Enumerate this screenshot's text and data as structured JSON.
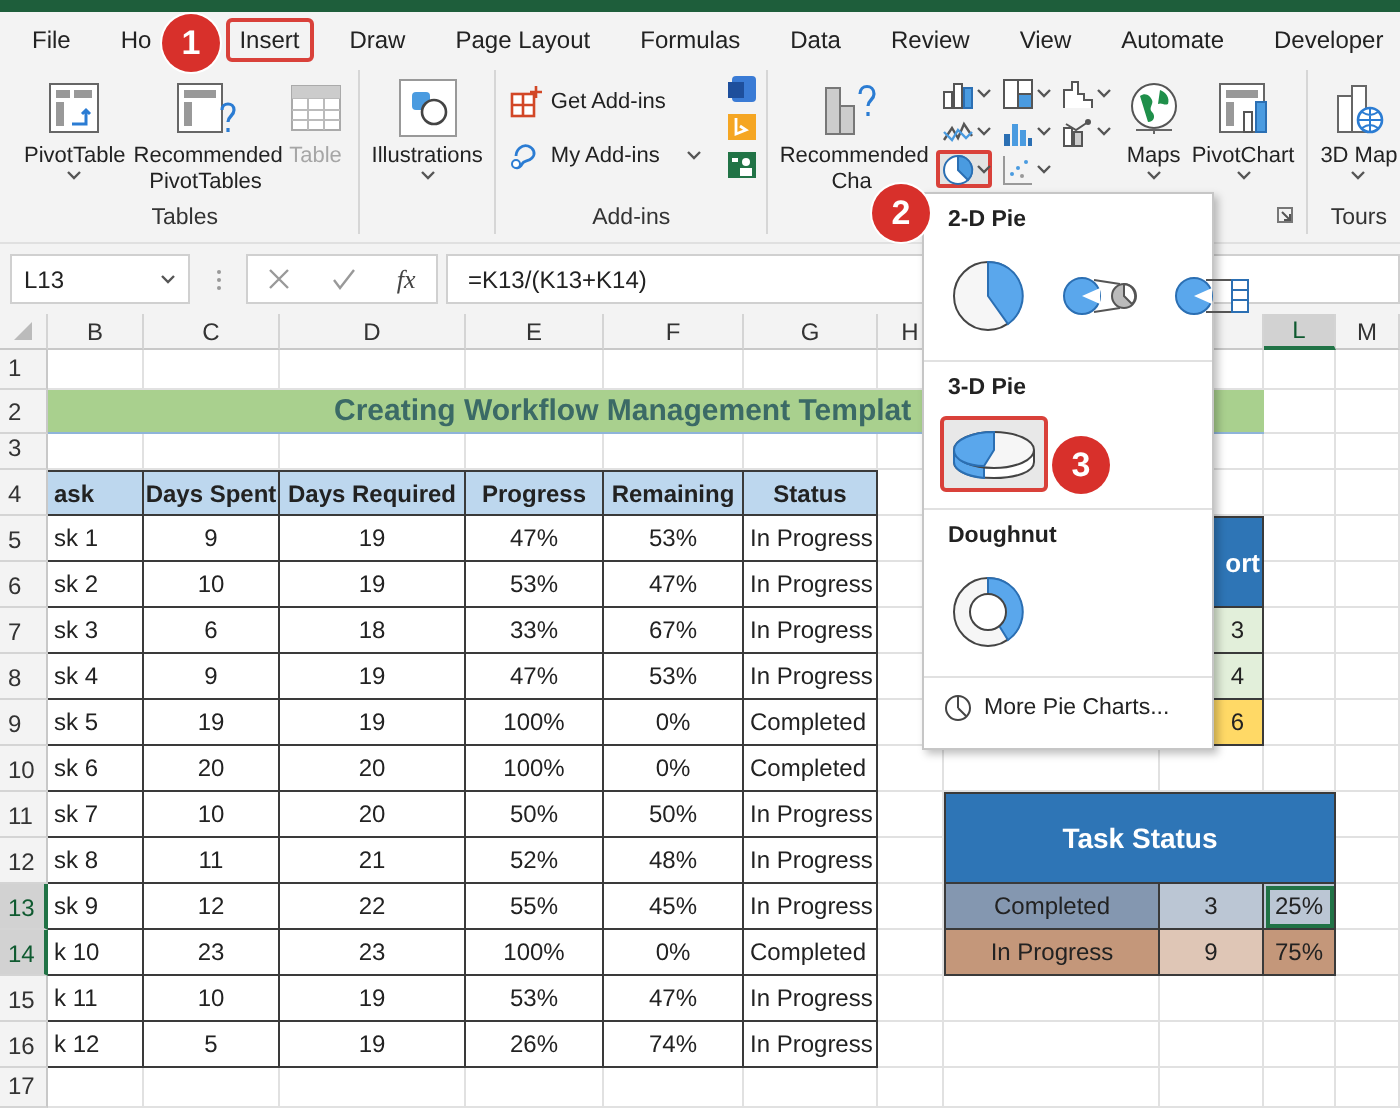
{
  "tabs": [
    {
      "label": "File",
      "selected": false
    },
    {
      "label": "Ho",
      "selected": false
    },
    {
      "label": "Insert",
      "selected": true
    },
    {
      "label": "Draw",
      "selected": false
    },
    {
      "label": "Page Layout",
      "selected": false
    },
    {
      "label": "Formulas",
      "selected": false
    },
    {
      "label": "Data",
      "selected": false
    },
    {
      "label": "Review",
      "selected": false
    },
    {
      "label": "View",
      "selected": false
    },
    {
      "label": "Automate",
      "selected": false
    },
    {
      "label": "Developer",
      "selected": false
    }
  ],
  "ribbon": {
    "groups": [
      {
        "label": "Tables",
        "items": [
          {
            "kind": "large",
            "label": "PivotTable",
            "dropdown": true,
            "disabled": false
          },
          {
            "kind": "large",
            "label": "Recommended PivotTables",
            "dropdown": false,
            "disabled": false
          },
          {
            "kind": "large",
            "label": "Table",
            "dropdown": false,
            "disabled": true
          }
        ]
      },
      {
        "items": [
          {
            "kind": "large",
            "label": "Illustrations",
            "dropdown": true,
            "disabled": false
          }
        ]
      },
      {
        "label": "Add-ins",
        "items": [
          {
            "kind": "small",
            "label": "Get Add-ins",
            "dropdown": false,
            "disabled": false
          },
          {
            "kind": "small",
            "label": "My Add-ins",
            "dropdown": true,
            "disabled": false
          },
          {
            "kind": "app-icons"
          }
        ]
      },
      {
        "items": [
          {
            "kind": "large",
            "label": "Recommended Cha",
            "dropdown": false,
            "disabled": false
          },
          {
            "kind": "chart-grid",
            "buttons": [
              {
                "selected": false
              },
              {
                "selected": false
              },
              {
                "selected": false
              },
              {
                "selected": false
              },
              {
                "selected": false
              },
              {
                "selected": false
              },
              {
                "selected": true
              },
              {
                "selected": false
              }
            ]
          },
          {
            "kind": "large",
            "label": "Maps",
            "dropdown": true,
            "disabled": false
          },
          {
            "kind": "large",
            "label": "PivotChart",
            "dropdown": true,
            "disabled": false
          }
        ]
      },
      {
        "label": "Tours",
        "items": [
          {
            "kind": "large",
            "label": "3D Map",
            "dropdown": true,
            "disabled": false
          }
        ]
      }
    ]
  },
  "callouts": [
    "1",
    "2",
    "3"
  ],
  "formula_bar": {
    "name_box": "L13",
    "function_button": "fx",
    "formula": "=K13/(K13+K14)"
  },
  "sheet": {
    "columns": [
      {
        "label": "B",
        "selected": false
      },
      {
        "label": "C",
        "selected": false
      },
      {
        "label": "D",
        "selected": false
      },
      {
        "label": "E",
        "selected": false
      },
      {
        "label": "F",
        "selected": false
      },
      {
        "label": "G",
        "selected": false
      },
      {
        "label": "H",
        "selected": false
      },
      {
        "label": "L",
        "selected": true
      },
      {
        "label": "M",
        "selected": false
      }
    ],
    "rows": [
      {
        "label": "1",
        "selected": false
      },
      {
        "label": "2",
        "selected": false
      },
      {
        "label": "3",
        "selected": false
      },
      {
        "label": "4",
        "selected": false
      },
      {
        "label": "5",
        "selected": false
      },
      {
        "label": "6",
        "selected": false
      },
      {
        "label": "7",
        "selected": false
      },
      {
        "label": "8",
        "selected": false
      },
      {
        "label": "9",
        "selected": false
      },
      {
        "label": "10",
        "selected": false
      },
      {
        "label": "11",
        "selected": false
      },
      {
        "label": "12",
        "selected": false
      },
      {
        "label": "13",
        "selected": true
      },
      {
        "label": "14",
        "selected": true
      },
      {
        "label": "15",
        "selected": false
      },
      {
        "label": "16",
        "selected": false
      },
      {
        "label": "17",
        "selected": false
      }
    ],
    "title": "Creating Workflow Management Templat",
    "table": {
      "header": [
        "ask",
        "Days Spent",
        "Days Required",
        "Progress",
        "Remaining",
        "Status"
      ],
      "rows": [
        [
          "sk 1",
          "9",
          "19",
          "47%",
          "53%",
          "In Progress"
        ],
        [
          "sk 2",
          "10",
          "19",
          "53%",
          "47%",
          "In Progress"
        ],
        [
          "sk 3",
          "6",
          "18",
          "33%",
          "67%",
          "In Progress"
        ],
        [
          "sk 4",
          "9",
          "19",
          "47%",
          "53%",
          "In Progress"
        ],
        [
          "sk 5",
          "19",
          "19",
          "100%",
          "0%",
          "Completed"
        ],
        [
          "sk 6",
          "20",
          "20",
          "100%",
          "0%",
          "Completed"
        ],
        [
          "sk 7",
          "10",
          "20",
          "50%",
          "50%",
          "In Progress"
        ],
        [
          "sk 8",
          "11",
          "21",
          "52%",
          "48%",
          "In Progress"
        ],
        [
          "sk 9",
          "12",
          "22",
          "55%",
          "45%",
          "In Progress"
        ],
        [
          "k 10",
          "23",
          "23",
          "100%",
          "0%",
          "Completed"
        ],
        [
          "k 11",
          "10",
          "19",
          "53%",
          "47%",
          "In Progress"
        ],
        [
          "k 12",
          "5",
          "19",
          "26%",
          "74%",
          "In Progress"
        ]
      ]
    },
    "side_table": {
      "header": "ort",
      "cells": [
        {
          "text": "3",
          "color": "#e2efda"
        },
        {
          "text": "4",
          "color": "#e2efda"
        },
        {
          "text": "6",
          "color": "#ffd966"
        }
      ]
    },
    "task_status": {
      "title": "Task Status",
      "rows": [
        {
          "label": "Completed",
          "count": "3",
          "share": "25%",
          "color": "#8497b0",
          "selected": true
        },
        {
          "label": "In Progress",
          "count": "9",
          "share": "75%",
          "color": "#c4977a",
          "selected": false
        }
      ]
    }
  },
  "pie_menu": {
    "sections": [
      {
        "title": "2-D Pie",
        "options": [
          {
            "selected": false
          },
          {
            "selected": false
          },
          {
            "selected": false
          }
        ]
      },
      {
        "title": "3-D Pie",
        "options": [
          {
            "selected": true
          }
        ]
      },
      {
        "title": "Doughnut",
        "options": [
          {
            "selected": false
          }
        ]
      }
    ],
    "more": "More Pie Charts..."
  }
}
